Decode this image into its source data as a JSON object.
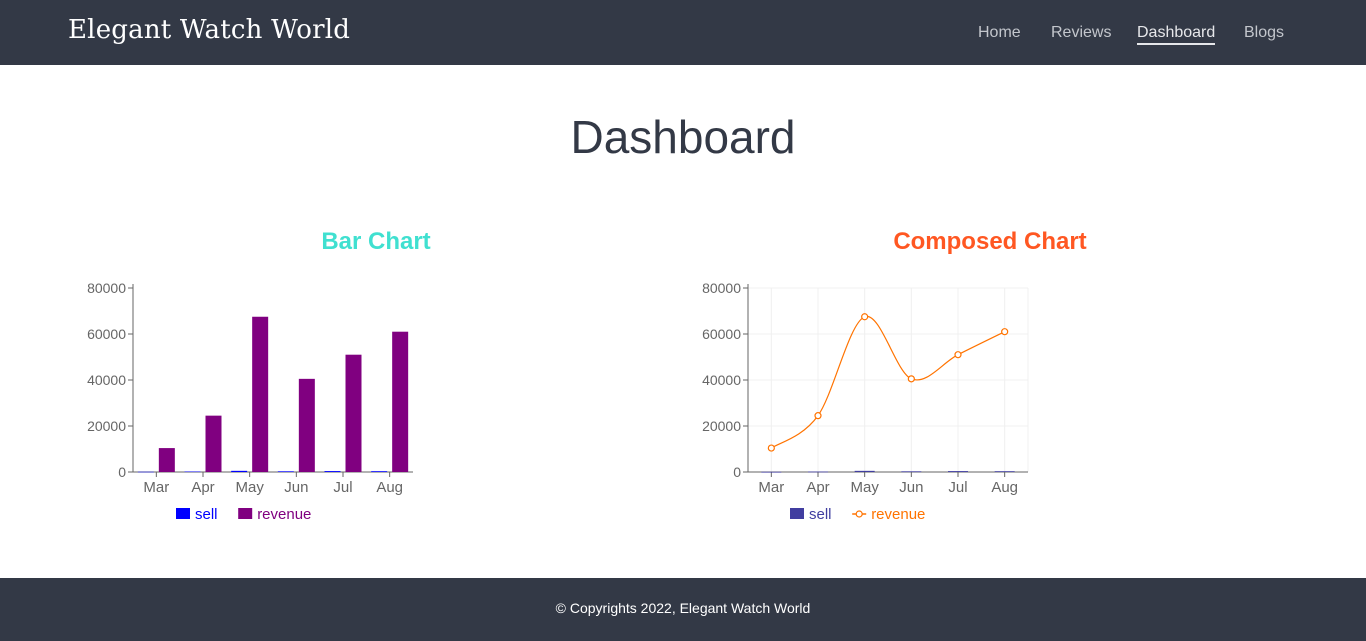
{
  "header": {
    "brand": "Elegant Watch World",
    "nav": [
      {
        "label": "Home"
      },
      {
        "label": "Reviews"
      },
      {
        "label": "Dashboard",
        "active": true
      },
      {
        "label": "Blogs"
      }
    ]
  },
  "main": {
    "title": "Dashboard"
  },
  "colors": {
    "bar_title": "#40e0d0",
    "composed_title": "#ff5722",
    "sell_bar": "#0000ff",
    "revenue_bar": "#800080",
    "sell_composed": "#413ea0",
    "revenue_line": "#ff7300"
  },
  "chart_data": [
    {
      "type": "bar",
      "title": "Bar Chart",
      "categories": [
        "Mar",
        "Apr",
        "May",
        "Jun",
        "Jul",
        "Aug"
      ],
      "series": [
        {
          "name": "sell",
          "values": [
            100,
            200,
            500,
            300,
            400,
            350
          ]
        },
        {
          "name": "revenue",
          "values": [
            10400,
            24500,
            67500,
            40500,
            51000,
            61000
          ]
        }
      ],
      "yticks": [
        "0",
        "20000",
        "40000",
        "60000",
        "80000"
      ],
      "ylim": [
        0,
        80000
      ],
      "grid": false,
      "legend": "bottom"
    },
    {
      "type": "line",
      "title": "Composed Chart",
      "categories": [
        "Mar",
        "Apr",
        "May",
        "Jun",
        "Jul",
        "Aug"
      ],
      "series": [
        {
          "name": "sell",
          "kind": "bar",
          "values": [
            100,
            200,
            500,
            300,
            400,
            350
          ]
        },
        {
          "name": "revenue",
          "kind": "line",
          "values": [
            10400,
            24500,
            67500,
            40500,
            51000,
            61000
          ]
        }
      ],
      "yticks": [
        "0",
        "20000",
        "40000",
        "60000",
        "80000"
      ],
      "ylim": [
        0,
        80000
      ],
      "grid": true,
      "legend": "bottom"
    }
  ],
  "footer": {
    "text": "© Copyrights 2022, Elegant Watch World"
  }
}
